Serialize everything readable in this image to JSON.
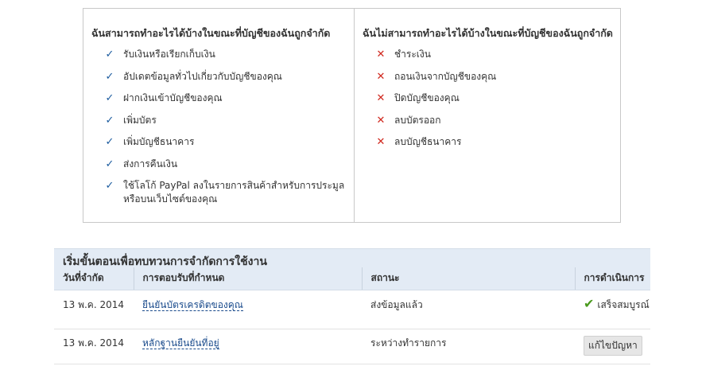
{
  "can_do": {
    "title": "ฉันสามารถทำอะไรได้บ้างในขณะที่บัญชีของฉันถูกจำกัด",
    "items": [
      "รับเงินหรือเรียกเก็บเงิน",
      "อัปเดตข้อมูลทั่วไปเกี่ยวกับบัญชีของคุณ",
      "ฝากเงินเข้าบัญชีของคุณ",
      "เพิ่มบัตร",
      "เพิ่มบัญชีธนาคาร",
      "ส่งการคืนเงิน",
      "ใช้โลโก้ PayPal ลงในรายการสินค้าสำหรับการประมูลหรือบนเว็บไซต์ของคุณ"
    ],
    "icon": "checkmark-icon",
    "icon_color": "#1a5a9e"
  },
  "cannot_do": {
    "title": "ฉันไม่สามารถทำอะไรได้บ้างในขณะที่บัญชีของฉันถูกจำกัด",
    "items": [
      "ชำระเงิน",
      "ถอนเงินจากบัญชีของคุณ",
      "ปิดบัญชีของคุณ",
      "ลบบัตรออก",
      "ลบบัญชีธนาคาร"
    ],
    "icon": "cross-icon",
    "icon_color": "#d0281e"
  },
  "review": {
    "title": "เริ่มขั้นตอนเพื่อทบทวนการจำกัดการใช้งาน",
    "columns": [
      "วันที่จำกัด",
      "การตอบรับที่กำหนด",
      "สถานะ",
      "การดำเนินการ"
    ],
    "rows": [
      {
        "date": "13 พ.ค. 2014",
        "response": "ยืนยันบัตรเครดิตของคุณ",
        "status": "ส่งข้อมูลแล้ว",
        "action": "เสร็จสมบูรณ์"
      },
      {
        "date": "13 พ.ค. 2014",
        "response": "หลักฐานยืนยันที่อยู่",
        "status": "ระหว่างทำรายการ",
        "action": "แก้ไขปัญหา"
      }
    ]
  }
}
